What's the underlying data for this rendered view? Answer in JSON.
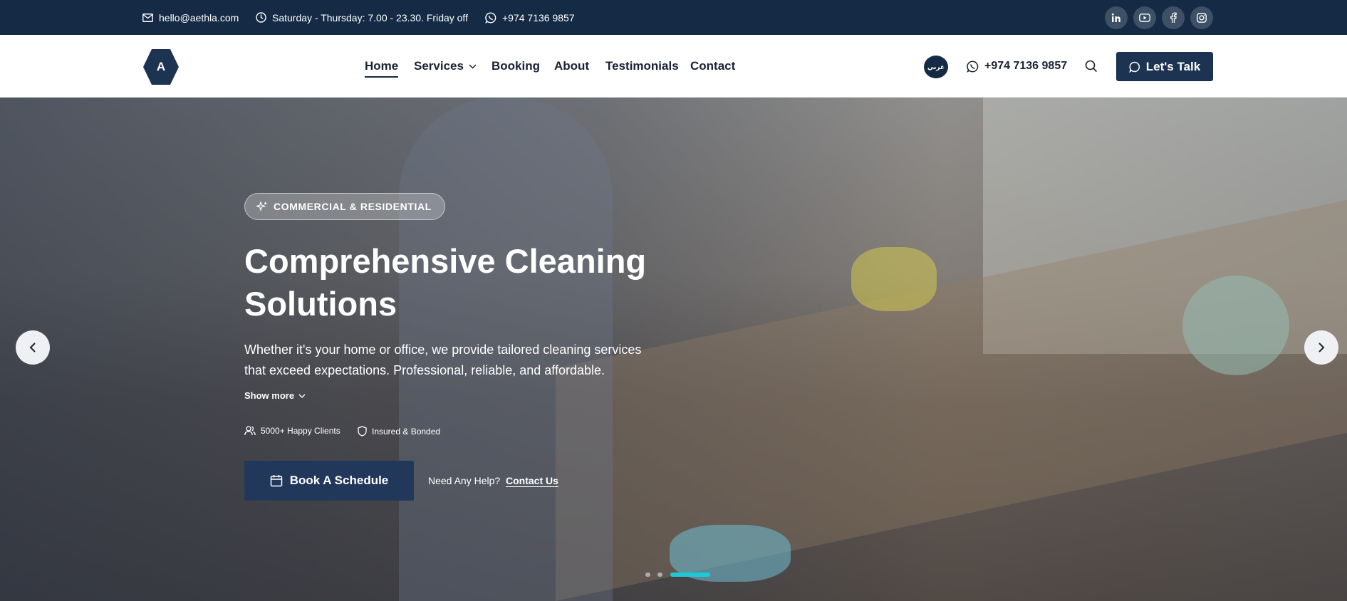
{
  "topbar": {
    "email": "hello@aethla.com",
    "hours": "Saturday - Thursday: 7.00 - 23.30. Friday off",
    "phone": "+974 7136 9857",
    "socials": [
      "linkedin-icon",
      "youtube-icon",
      "facebook-icon",
      "instagram-icon"
    ]
  },
  "header": {
    "logo_letter": "A",
    "nav": {
      "home": "Home",
      "services": "Services",
      "booking": "Booking",
      "about": "About",
      "testimonials": "Testimonials",
      "contact": "Contact"
    },
    "language": "عربي",
    "phone": "+974 7136 9857",
    "cta": "Let's Talk"
  },
  "hero": {
    "badge": "COMMERCIAL & RESIDENTIAL",
    "title_line1": "Comprehensive Cleaning",
    "title_line2": "Solutions",
    "desc_line1": "Whether it's your home or office, we provide tailored cleaning services",
    "desc_line2": "that exceed expectations. Professional, reliable, and affordable.",
    "show_more": "Show more",
    "feature_clients": "5000+ Happy Clients",
    "feature_insured": "Insured & Bonded",
    "book_label": "Book A Schedule",
    "help_text": "Need Any Help?",
    "contact_link": "Contact Us",
    "slides_total": 3,
    "active_slide": 3
  },
  "colors": {
    "navy": "#142a45",
    "button": "#1c3352",
    "accent_dot": "#1ec8d8"
  }
}
